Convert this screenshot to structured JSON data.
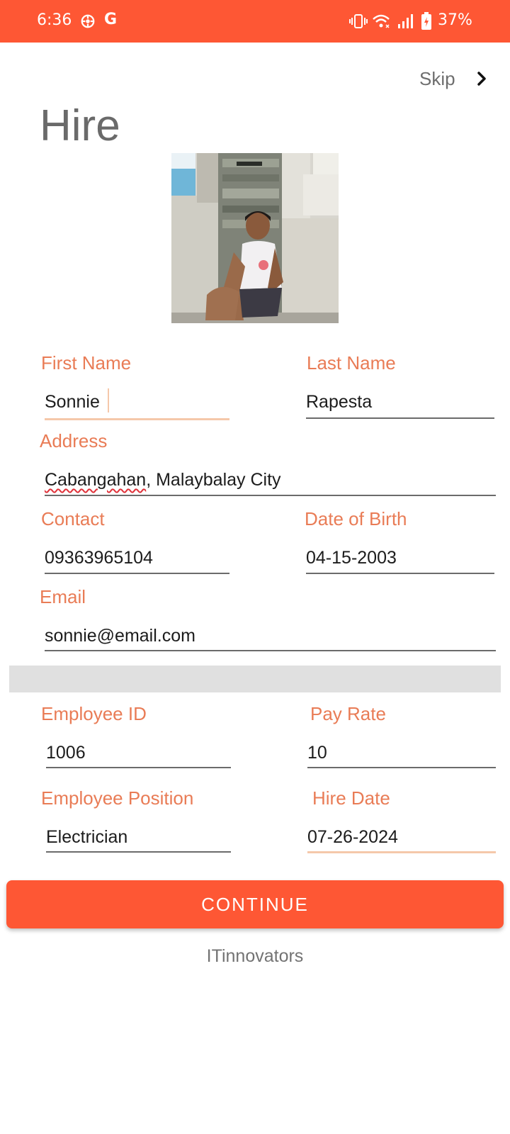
{
  "status_bar": {
    "time": "6:36",
    "g_label": "G",
    "battery": "37%",
    "color": "#fe5734",
    "icons": [
      "gear-icon",
      "vibrate-icon",
      "wifi-icon",
      "signal-icon",
      "battery-icon"
    ]
  },
  "header": {
    "skip_label": "Skip",
    "title": "Hire"
  },
  "profile_photo": {
    "icon": "profile-photo"
  },
  "form": {
    "first_name": {
      "label": "First Name",
      "value": "Sonnie"
    },
    "last_name": {
      "label": "Last Name",
      "value": "Rapesta"
    },
    "address": {
      "label": "Address",
      "value_misspelled": "Cabangahan",
      "value_rest": ", Malaybalay City"
    },
    "contact": {
      "label": "Contact",
      "value": "09363965104"
    },
    "date_of_birth": {
      "label": "Date of Birth",
      "value": "04-15-2003"
    },
    "email": {
      "label": "Email",
      "value": "sonnie@email.com"
    },
    "employee_id": {
      "label": "Employee ID",
      "value": "1006"
    },
    "pay_rate": {
      "label": "Pay Rate",
      "value": "10"
    },
    "employee_position": {
      "label": "Employee Position",
      "value": "Electrician"
    },
    "hire_date": {
      "label": "Hire Date",
      "value": "07-26-2024"
    }
  },
  "actions": {
    "continue_label": "CONTINUE"
  },
  "footer": {
    "brand": "ITinnovators"
  },
  "colors": {
    "accent": "#fe5734",
    "label": "#e97c56",
    "focus_line": "#f5c8aa"
  }
}
